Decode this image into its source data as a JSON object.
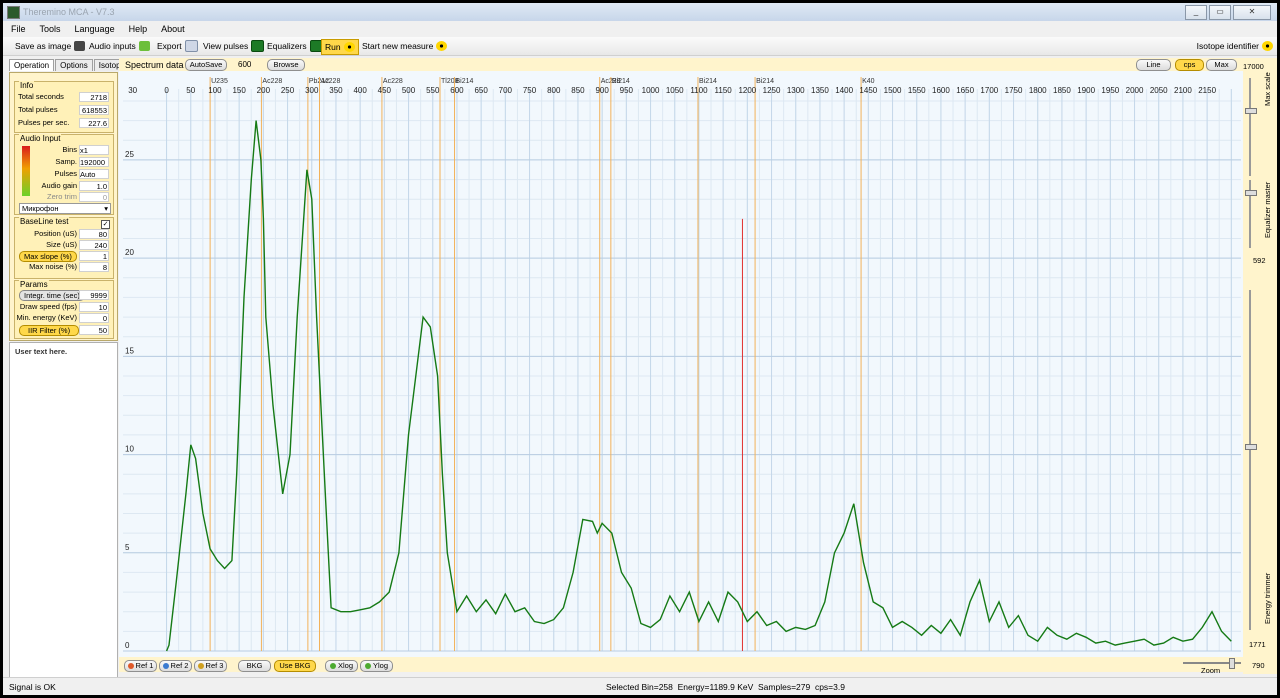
{
  "window": {
    "title": "Theremino MCA - V7.3",
    "btn_min": "_",
    "btn_max": "▭",
    "btn_close": "✕"
  },
  "menu": [
    "File",
    "Tools",
    "Language",
    "Help",
    "About"
  ],
  "toolbar": {
    "save_image": "Save as image",
    "audio_inputs": "Audio inputs",
    "export": "Export",
    "view_pulses": "View pulses",
    "equalizers": "Equalizers",
    "run": "Run",
    "start_new": "Start new measure",
    "isotope_identifier": "Isotope identifier"
  },
  "tabs": [
    "Operation",
    "Options",
    "Isotopes"
  ],
  "info": {
    "title": "Info",
    "total_seconds_label": "Total seconds",
    "total_seconds": "2718",
    "total_pulses_label": "Total pulses",
    "total_pulses": "618553",
    "pulses_per_sec_label": "Pulses per sec.",
    "pulses_per_sec": "227.6"
  },
  "audio_input": {
    "title": "Audio Input",
    "bins_label": "Bins",
    "bins": "x1",
    "samp_label": "Samp.",
    "samp": "192000",
    "pulses_label": "Pulses",
    "pulses": "Auto",
    "gain_label": "Audio gain",
    "gain": "1.0",
    "zero_trim_label": "Zero trim",
    "zero_trim": "0",
    "device": "Микрофон"
  },
  "baseline": {
    "title": "BaseLine test",
    "position_label": "Position (uS)",
    "position": "80",
    "size_label": "Size (uS)",
    "size": "240",
    "max_slope_label": "Max slope (%)",
    "max_slope": "1",
    "max_noise_label": "Max noise (%)",
    "max_noise": "8"
  },
  "params": {
    "title": "Params",
    "integr_label": "Integr. time (sec)",
    "integr": "9999",
    "draw_speed_label": "Draw speed (fps)",
    "draw_speed": "10",
    "min_energy_label": "Min. energy (KeV)",
    "min_energy": "0",
    "iir_label": "IIR Filter (%)",
    "iir": "50"
  },
  "user_text": "User text here.",
  "spectrum_bar": {
    "label": "Spectrum data",
    "autosave": "AutoSave",
    "value": "600",
    "browse": "Browse",
    "line": "Line",
    "cps": "cps",
    "max": "Max",
    "scale_top": "17000"
  },
  "right_panel": {
    "max_scale": "Max scale",
    "eq_master": "Equalizer master",
    "eq_value": "592",
    "energy_trimmer": "Energy trimmer",
    "trim_value": "1771",
    "zoom_value": "790",
    "zoom": "Zoom"
  },
  "bottom_buttons": {
    "ref1": "Ref 1",
    "ref2": "Ref 2",
    "ref3": "Ref 3",
    "bkg": "BKG",
    "use_bkg": "Use BKG",
    "xlog": "Xlog",
    "ylog": "Ylog"
  },
  "status": {
    "left": "Signal is OK",
    "center": "Selected Bin=258  Energy=1189.9 KeV  Samples=279  cps=3.9"
  },
  "chart_data": {
    "type": "line",
    "xlabel": "",
    "ylabel": "",
    "xlim": [
      -90,
      2220
    ],
    "ylim": [
      0,
      28
    ],
    "x_ticks": [
      30,
      0,
      50,
      100,
      150,
      200,
      250,
      300,
      350,
      400,
      450,
      500,
      550,
      600,
      650,
      700,
      750,
      800,
      850,
      900,
      950,
      1000,
      1050,
      1100,
      1150,
      1200,
      1250,
      1300,
      1350,
      1400,
      1450,
      1500,
      1550,
      1600,
      1650,
      1700,
      1750,
      1800,
      1850,
      1900,
      1950,
      2000,
      2050,
      2100,
      2150
    ],
    "y_ticks": [
      0,
      5,
      10,
      15,
      20,
      25
    ],
    "grid": true,
    "isotope_lines": [
      {
        "label": "U235",
        "x": 90
      },
      {
        "label": "Ac228",
        "x": 196
      },
      {
        "label": "Pb212",
        "x": 292
      },
      {
        "label": "Ac228",
        "x": 316
      },
      {
        "label": "Ac228",
        "x": 445
      },
      {
        "label": "Tl208",
        "x": 565
      },
      {
        "label": "Bi214",
        "x": 595
      },
      {
        "label": "Ac228",
        "x": 895
      },
      {
        "label": "Bi214",
        "x": 918
      },
      {
        "label": "Bi214",
        "x": 1098
      },
      {
        "label": "Bi214",
        "x": 1216
      },
      {
        "label": "K40",
        "x": 1435
      }
    ],
    "selected_energy": 1189.9,
    "series": [
      {
        "x": [
          0,
          5,
          20,
          40,
          50,
          60,
          75,
          90,
          105,
          120,
          135,
          145,
          160,
          175,
          185,
          195,
          200,
          205,
          220,
          240,
          255,
          270,
          290,
          300,
          310,
          320,
          330,
          340,
          360,
          380,
          400,
          420,
          440,
          460,
          480,
          500,
          530,
          545,
          560,
          570,
          580,
          600,
          620,
          640,
          660,
          680,
          700,
          720,
          740,
          760,
          780,
          800,
          820,
          840,
          860,
          880,
          890,
          900,
          920,
          940,
          960,
          980,
          1000,
          1020,
          1040,
          1060,
          1080,
          1100,
          1120,
          1140,
          1160,
          1180,
          1200,
          1220,
          1240,
          1260,
          1280,
          1300,
          1320,
          1340,
          1360,
          1380,
          1400,
          1420,
          1440,
          1460,
          1480,
          1500,
          1520,
          1540,
          1560,
          1580,
          1600,
          1620,
          1640,
          1660,
          1680,
          1700,
          1720,
          1740,
          1760,
          1780,
          1800,
          1820,
          1840,
          1860,
          1880,
          1900,
          1920,
          1940,
          1960,
          1980,
          2000,
          2020,
          2040,
          2060,
          2080,
          2100,
          2120,
          2140,
          2160,
          2180,
          2200
        ],
        "values": [
          0,
          0.3,
          3.5,
          8,
          10.5,
          9.8,
          7,
          5.2,
          4.6,
          4.2,
          4.6,
          9,
          18,
          24,
          27,
          25,
          22,
          17,
          12.5,
          8,
          10,
          17,
          24.5,
          23,
          17,
          12,
          7,
          2.2,
          2,
          2,
          2.1,
          2.2,
          2.5,
          3,
          5,
          11,
          17,
          16.5,
          14,
          9,
          5,
          2,
          2.8,
          2,
          2.6,
          1.9,
          2.9,
          2,
          2.2,
          1.5,
          1.4,
          1.6,
          2.2,
          4,
          6.7,
          6.6,
          6,
          6.5,
          6,
          4,
          3.2,
          1.4,
          1.2,
          1.6,
          2.8,
          2,
          3,
          1.5,
          2.5,
          1.5,
          3,
          2.5,
          1.5,
          2,
          1.3,
          1.5,
          1,
          1.2,
          1.1,
          1.3,
          2.5,
          5,
          6,
          7.5,
          4.5,
          2.5,
          2.2,
          1.2,
          1.5,
          1.2,
          0.8,
          1.3,
          0.9,
          1.6,
          0.8,
          2.5,
          3.6,
          1.5,
          2.5,
          1.2,
          1.8,
          0.8,
          0.5,
          1.2,
          0.8,
          0.6,
          0.9,
          0.7,
          0.4,
          0.5,
          0.3,
          0.4,
          0.5,
          0.6,
          0.3,
          0.4,
          0.7,
          0.5,
          0.6,
          1.2,
          2,
          1,
          0.5
        ]
      }
    ]
  }
}
